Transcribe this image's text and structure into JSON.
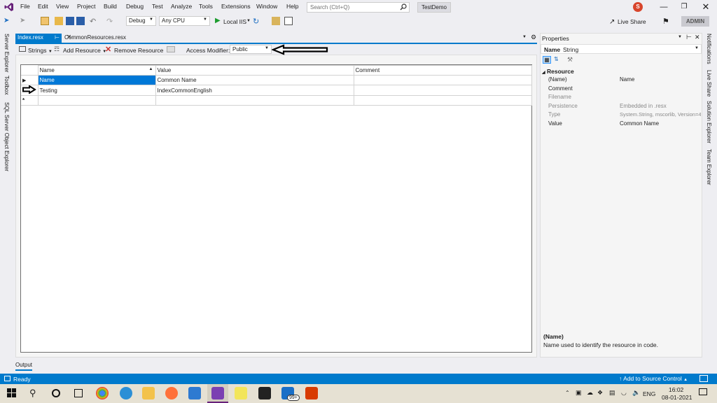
{
  "menu": [
    "File",
    "Edit",
    "View",
    "Project",
    "Build",
    "Debug",
    "Test",
    "Analyze",
    "Tools",
    "Extensions",
    "Window",
    "Help"
  ],
  "search": {
    "placeholder": "Search (Ctrl+Q)"
  },
  "solution_name": "TestDemo",
  "user_initial": "S",
  "toolbar": {
    "config": "Debug",
    "platform": "Any CPU",
    "run_target": "Local IIS",
    "live_share": "Live Share",
    "admin": "ADMIN"
  },
  "left_strip": [
    "Server Explorer",
    "Toolbox",
    "SQL Server Object Explorer"
  ],
  "right_strip": [
    "Notifications",
    "Live Share",
    "Solution Explorer",
    "Team Explorer"
  ],
  "tabs": {
    "active": "Index.resx",
    "other": "CommonResources.resx"
  },
  "editor_toolbar": {
    "strings": "Strings",
    "add": "Add Resource",
    "remove": "Remove Resource",
    "access_label": "Access Modifier:",
    "access_value": "Public"
  },
  "grid": {
    "headers": [
      "Name",
      "Value",
      "Comment"
    ],
    "rows": [
      {
        "name": "Name",
        "value": "Common Name",
        "comment": ""
      },
      {
        "name": "Testing",
        "value": "IndexCommonEnglish",
        "comment": ""
      }
    ]
  },
  "properties": {
    "title": "Properties",
    "object_name": "Name",
    "object_type": "String",
    "category": "Resource",
    "rows": [
      {
        "key": "(Name)",
        "value": "Name",
        "dim": false
      },
      {
        "key": "Comment",
        "value": "",
        "dim": false
      },
      {
        "key": "Filename",
        "value": "",
        "dim": true
      },
      {
        "key": "Persistence",
        "value": "Embedded in .resx",
        "dim": true
      },
      {
        "key": "Type",
        "value": "System.String, mscorlib, Version=4",
        "dim": true
      },
      {
        "key": "Value",
        "value": "Common Name",
        "dim": false
      }
    ],
    "desc_title": "(Name)",
    "desc_text": "Name used to identify the resource in code."
  },
  "output_tab": "Output",
  "status": {
    "ready": "Ready",
    "source_control": "Add to Source Control"
  },
  "taskbar": {
    "lang": "ENG",
    "time": "16:02",
    "date": "08-01-2021",
    "mail_badge": "99+"
  },
  "colors": {
    "accent": "#007acc",
    "vs_purple": "#68217a",
    "selection": "#0078d7"
  }
}
